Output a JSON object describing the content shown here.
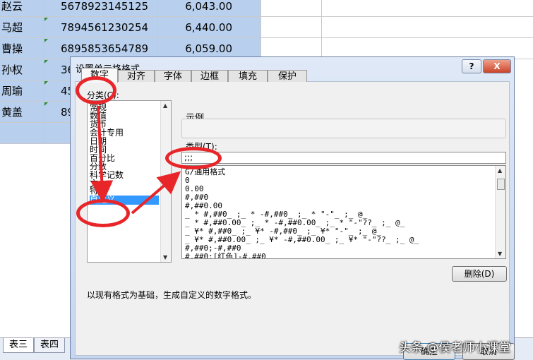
{
  "sheet": {
    "rows": [
      {
        "name": "赵云",
        "id": "5678923145125",
        "amount": "6,043.00"
      },
      {
        "name": "马超",
        "id": "7894561230254",
        "amount": "6,440.00"
      },
      {
        "name": "曹操",
        "id": "6895853654789",
        "amount": "6,059.00"
      },
      {
        "name": "孙权",
        "id": "36",
        "amount": ""
      },
      {
        "name": "周瑜",
        "id": "45",
        "amount": ""
      },
      {
        "name": "黄盖",
        "id": "89",
        "amount": ""
      }
    ],
    "tabs": [
      "表三",
      "表四"
    ]
  },
  "dialog": {
    "title": "设置单元格格式",
    "help_label": "?",
    "close_label": "X",
    "tabs": [
      "数字",
      "对齐",
      "字体",
      "边框",
      "填充",
      "保护"
    ],
    "category_label": "分类(C):",
    "categories": [
      "常规",
      "数值",
      "货币",
      "会计专用",
      "日期",
      "时间",
      "百分比",
      "分数",
      "科学记数",
      "文本",
      "特殊",
      "自定义"
    ],
    "selected_category": "自定义",
    "sample_label": "示例",
    "type_label": "类型(T):",
    "type_value": ";;;",
    "formats": [
      "G/通用格式",
      "0",
      "0.00",
      "#,##0",
      "#,##0.00",
      "_ * #,##0_ ;_ * -#,##0_ ;_ * \"-\"_ ;_ @_",
      "_ * #,##0.00_ ;_ * -#,##0.00_ ;_ * \"-\"??_ ;_ @_",
      "_ ¥* #,##0_ ;_ ¥* -#,##0_ ;_ ¥* \"-\"_ ;_ @_",
      "_ ¥* #,##0.00_ ;_ ¥* -#,##0.00_ ;_ ¥* \"-\"??_ ;_ @_",
      "#,##0;-#,##0",
      "#,##0;[红色]-#,##0"
    ],
    "delete_label": "删除(D)",
    "description": "以现有格式为基础，生成自定义的数字格式。",
    "ok_label": "确定",
    "cancel_label": "取消"
  },
  "annotation_color": "#e8262a",
  "watermark": "头条 @侯老师小课堂"
}
